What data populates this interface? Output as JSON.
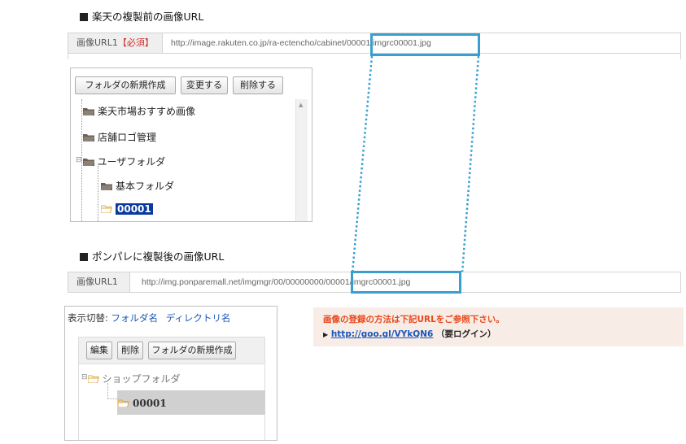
{
  "section1": {
    "heading": "楽天の複製前の画像URL",
    "url_label": "画像URL1",
    "url_required": "【必須】",
    "url_value": "http://image.rakuten.co.jp/ra-ectencho/cabinet/00001/imgrc00001.jpg",
    "toolbar": {
      "new_folder": "フォルダの新規作成",
      "rename": "変更する",
      "delete": "削除する"
    },
    "tree": [
      {
        "label": "楽天市場おすすめ画像"
      },
      {
        "label": "店舗ロゴ管理"
      },
      {
        "label": "ユーザフォルダ"
      },
      {
        "label": "基本フォルダ"
      },
      {
        "label": "00001"
      }
    ]
  },
  "section2": {
    "heading": "ポンパレに複製後の画像URL",
    "url_label": "画像URL1",
    "url_value": "http://img.ponparemall.net/imgmgr/00/00000000/00001/imgrc00001.jpg",
    "display_toggle": {
      "label": "表示切替:",
      "option1": "フォルダ名",
      "option2": "ディレクトリ名"
    },
    "toolbar": {
      "edit": "編集",
      "delete": "削除",
      "new_folder": "フォルダの新規作成"
    },
    "tree": [
      {
        "label": "ショップフォルダ"
      },
      {
        "label": "00001"
      }
    ]
  },
  "info": {
    "title": "画像の登録の方法は下記URLをご参照下さい。",
    "link_text": "http://goo.gl/VYkQN6",
    "note": "（要ログイン）"
  },
  "colors": {
    "highlight": "#3a9fd0",
    "selected": "#0a3aa0",
    "required": "#d32f2f",
    "info_title": "#e8491d",
    "info_bg": "#f7ece6",
    "link": "#1a56b8"
  }
}
